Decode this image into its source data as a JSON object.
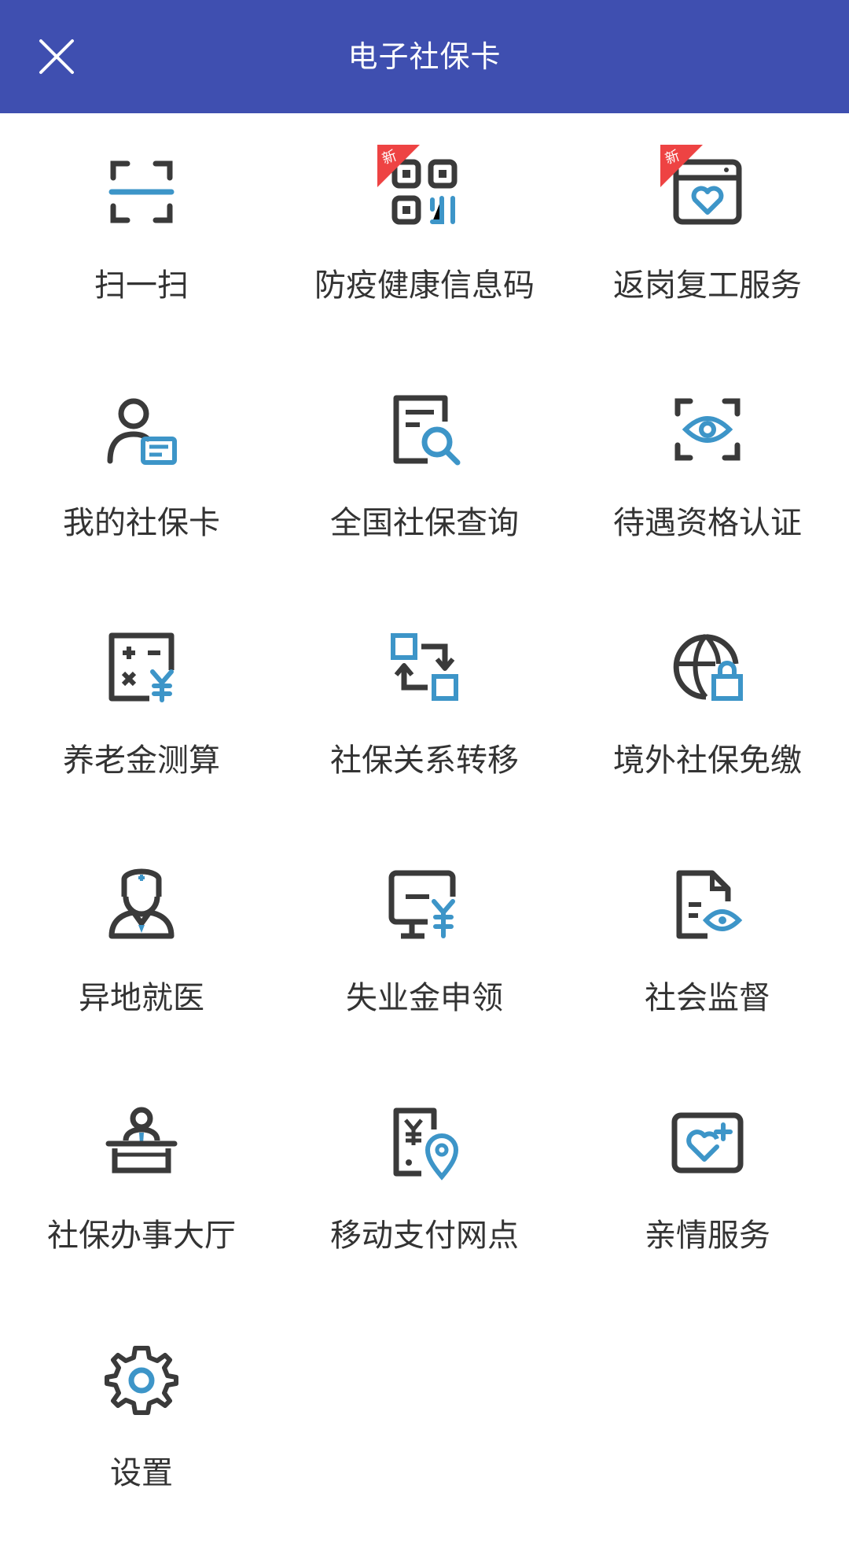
{
  "header": {
    "title": "电子社保卡",
    "close_icon": "close-icon"
  },
  "colors": {
    "header_bg": "#3f4fb0",
    "icon_dark": "#3a3a3a",
    "icon_accent": "#3d95c8",
    "badge": "#ee4343"
  },
  "badge_label": "新",
  "items": [
    {
      "label": "扫一扫",
      "icon": "scan-icon"
    },
    {
      "label": "防疫健康信息码",
      "icon": "qr-code-icon",
      "badge": true
    },
    {
      "label": "返岗复工服务",
      "icon": "calendar-heart-icon",
      "badge": true
    },
    {
      "label": "我的社保卡",
      "icon": "user-card-icon"
    },
    {
      "label": "全国社保查询",
      "icon": "document-search-icon"
    },
    {
      "label": "待遇资格认证",
      "icon": "eye-scan-icon"
    },
    {
      "label": "养老金测算",
      "icon": "calculator-yuan-icon"
    },
    {
      "label": "社保关系转移",
      "icon": "transfer-icon"
    },
    {
      "label": "境外社保免缴",
      "icon": "globe-lock-icon"
    },
    {
      "label": "异地就医",
      "icon": "doctor-icon"
    },
    {
      "label": "失业金申领",
      "icon": "monitor-yuan-icon"
    },
    {
      "label": "社会监督",
      "icon": "document-eye-icon"
    },
    {
      "label": "社保办事大厅",
      "icon": "service-desk-icon"
    },
    {
      "label": "移动支付网点",
      "icon": "payment-location-icon"
    },
    {
      "label": "亲情服务",
      "icon": "heart-card-icon"
    },
    {
      "label": "设置",
      "icon": "gear-icon"
    }
  ]
}
